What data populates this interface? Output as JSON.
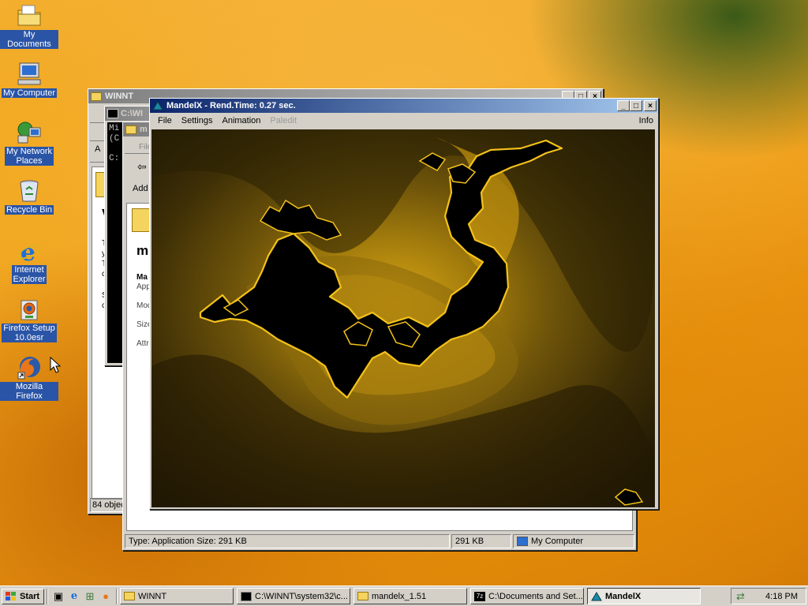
{
  "desktop": {
    "icons": [
      {
        "label": "My Documents"
      },
      {
        "label": "My Computer"
      },
      {
        "label": "My Network Places",
        "line1": "My Network",
        "line2": "Places"
      },
      {
        "label": "Recycle Bin"
      },
      {
        "label": "Internet Explorer",
        "line1": "Internet",
        "line2": "Explorer"
      },
      {
        "label": "Firefox Setup 10.0esr",
        "line1": "Firefox Setup",
        "line2": "10.0esr"
      },
      {
        "label": "Mozilla Firefox"
      }
    ]
  },
  "winnt_window": {
    "title": "WINNT",
    "status_left": "84 objec"
  },
  "cmd_window": {
    "title": "C:\\WI",
    "line1": "Mi",
    "line2": "(C",
    "line3": "C:"
  },
  "explorer_window": {
    "title": "m",
    "toolbar_file": "File",
    "address_label": "Add",
    "heading": "m",
    "props": {
      "name": "Ma",
      "type": "App",
      "modified": "Mod",
      "size": "Size",
      "attributes": "Attr"
    },
    "status_type": "Type: Application Size: 291 KB",
    "status_size": "291 KB",
    "status_zone": "My Computer"
  },
  "winnt_side": {
    "c1": "T",
    "c2": "y",
    "c3": "T",
    "c4": "c",
    "c5": "S",
    "c6": "c"
  },
  "mandelx_window": {
    "title": "MandelX - Rend.Time:  0.27 sec.",
    "menu": {
      "file": "File",
      "settings": "Settings",
      "animation": "Animation",
      "paledit": "Paledit",
      "info": "Info"
    }
  },
  "taskbar": {
    "start": "Start",
    "tasks": [
      {
        "label": "WINNT"
      },
      {
        "label": "C:\\WINNT\\system32\\c..."
      },
      {
        "label": "mandelx_1.51"
      },
      {
        "label": "C:\\Documents and Set..."
      },
      {
        "label": "MandelX"
      }
    ],
    "clock": "4:18 PM"
  },
  "colors": {
    "accent": "#0a246a",
    "fractal_gold": "#f0b80c",
    "desktop_orange": "#f0a21a"
  }
}
